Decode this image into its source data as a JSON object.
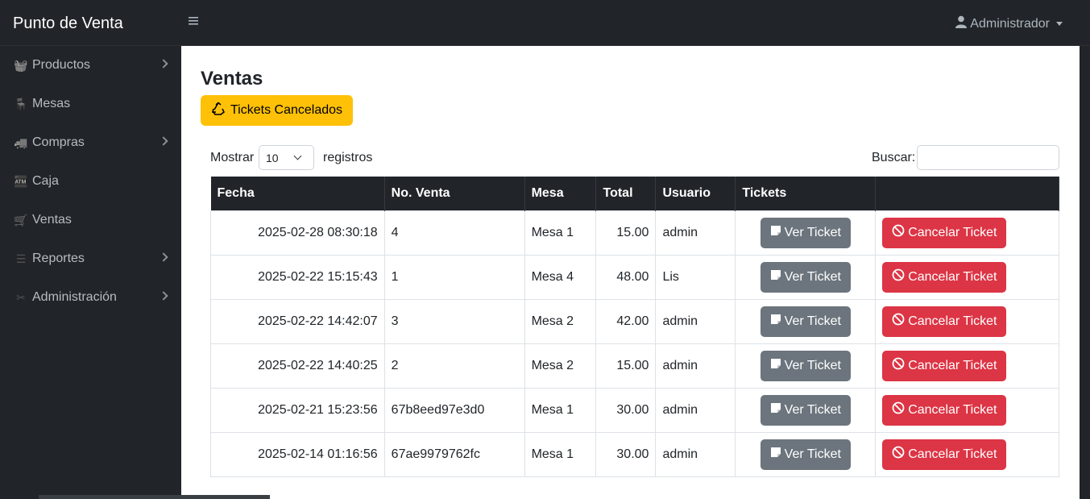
{
  "app": {
    "brand": "Punto de Venta",
    "user": "Administrador"
  },
  "sidebar": {
    "items": [
      {
        "label": "Productos",
        "icon": "basket-icon",
        "glyph": "🧺",
        "has_children": true
      },
      {
        "label": "Mesas",
        "icon": "table-icon",
        "glyph": "🪑",
        "has_children": false
      },
      {
        "label": "Compras",
        "icon": "truck-icon",
        "glyph": "🚚",
        "has_children": true
      },
      {
        "label": "Caja",
        "icon": "cash-register-icon",
        "glyph": "🏧",
        "has_children": false
      },
      {
        "label": "Ventas",
        "icon": "cart-icon",
        "glyph": "🛒",
        "has_children": false
      },
      {
        "label": "Reportes",
        "icon": "list-icon",
        "glyph": "☰",
        "has_children": true
      },
      {
        "label": "Administración",
        "icon": "tools-icon",
        "glyph": "✂",
        "has_children": true
      }
    ]
  },
  "page": {
    "title": "Ventas",
    "cancelled_button": "Tickets Cancelados"
  },
  "table_controls": {
    "show_label": "Mostrar",
    "page_size": "10",
    "records_label": "registros",
    "search_label": "Buscar:",
    "search_value": ""
  },
  "table": {
    "headers": [
      "Fecha",
      "No. Venta",
      "Mesa",
      "Total",
      "Usuario",
      "Tickets",
      ""
    ],
    "view_label": "Ver Ticket",
    "cancel_label": "Cancelar Ticket",
    "rows": [
      {
        "fecha": "2025-02-28 08:30:18",
        "venta": "4",
        "mesa": "Mesa 1",
        "total": "15.00",
        "usuario": "admin"
      },
      {
        "fecha": "2025-02-22 15:15:43",
        "venta": "1",
        "mesa": "Mesa 4",
        "total": "48.00",
        "usuario": "Lis"
      },
      {
        "fecha": "2025-02-22 14:42:07",
        "venta": "3",
        "mesa": "Mesa 2",
        "total": "42.00",
        "usuario": "admin"
      },
      {
        "fecha": "2025-02-22 14:40:25",
        "venta": "2",
        "mesa": "Mesa 2",
        "total": "15.00",
        "usuario": "admin"
      },
      {
        "fecha": "2025-02-21 15:23:56",
        "venta": "67b8eed97e3d0",
        "mesa": "Mesa 1",
        "total": "30.00",
        "usuario": "admin"
      },
      {
        "fecha": "2025-02-14 01:16:56",
        "venta": "67ae9979762fc",
        "mesa": "Mesa 1",
        "total": "30.00",
        "usuario": "admin"
      }
    ]
  },
  "colors": {
    "dark": "#212529",
    "warning": "#ffc107",
    "secondary": "#6c757d",
    "danger": "#dc3545"
  }
}
